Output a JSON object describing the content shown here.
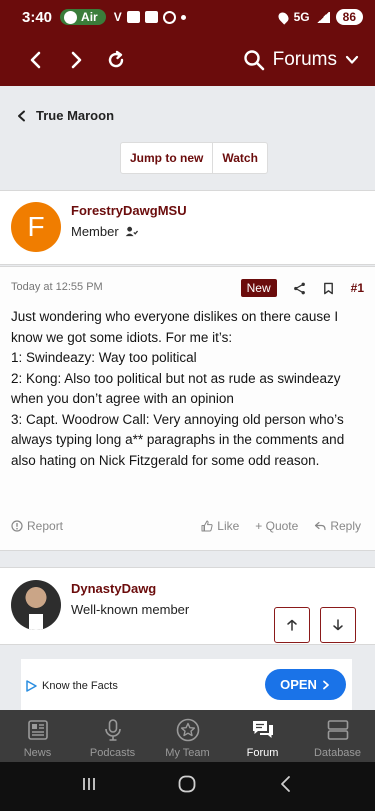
{
  "status_bar": {
    "time": "3:40",
    "air_label": "Air",
    "carrier_glyph": "V",
    "network": "5G",
    "battery": "86"
  },
  "browser": {
    "section_label": "Forums"
  },
  "thread": {
    "back_label": "True Maroon",
    "jump_to_new": "Jump to new",
    "watch": "Watch"
  },
  "post1": {
    "avatar_letter": "F",
    "username": "ForestryDawgMSU",
    "user_title": "Member",
    "date": "Today at 12:55 PM",
    "badge": "New",
    "number": "#1",
    "lines": [
      "Just wondering who everyone dislikes on there cause I know we got some idiots. For me it’s:",
      "1: Swindeazy: Way too political",
      "2: Kong: Also too political but not as rude as swindeazy when you don’t agree with an opinion",
      "3: Capt. Woodrow Call: Very annoying old person who’s always typing long a** paragraphs in the comments and also hating on Nick Fitzgerald for some odd reason."
    ],
    "actions": {
      "report": "Report",
      "like": "Like",
      "quote": "+ Quote",
      "reply": "Reply"
    }
  },
  "post2": {
    "username": "DynastyDawg",
    "user_title": "Well-known member"
  },
  "ad": {
    "text": "Know the Facts",
    "button": "OPEN"
  },
  "tabs": [
    {
      "label": "News",
      "icon": "news-icon"
    },
    {
      "label": "Podcasts",
      "icon": "microphone-icon"
    },
    {
      "label": "My Team",
      "icon": "star-icon"
    },
    {
      "label": "Forum",
      "icon": "forum-icon",
      "active": true
    },
    {
      "label": "Database",
      "icon": "database-icon"
    }
  ],
  "colors": {
    "brand_maroon": "#6b0c0c",
    "avatar_orange": "#f07d00",
    "ad_button_blue": "#1a73e8",
    "tab_bar_bg": "#3c3c3c"
  }
}
